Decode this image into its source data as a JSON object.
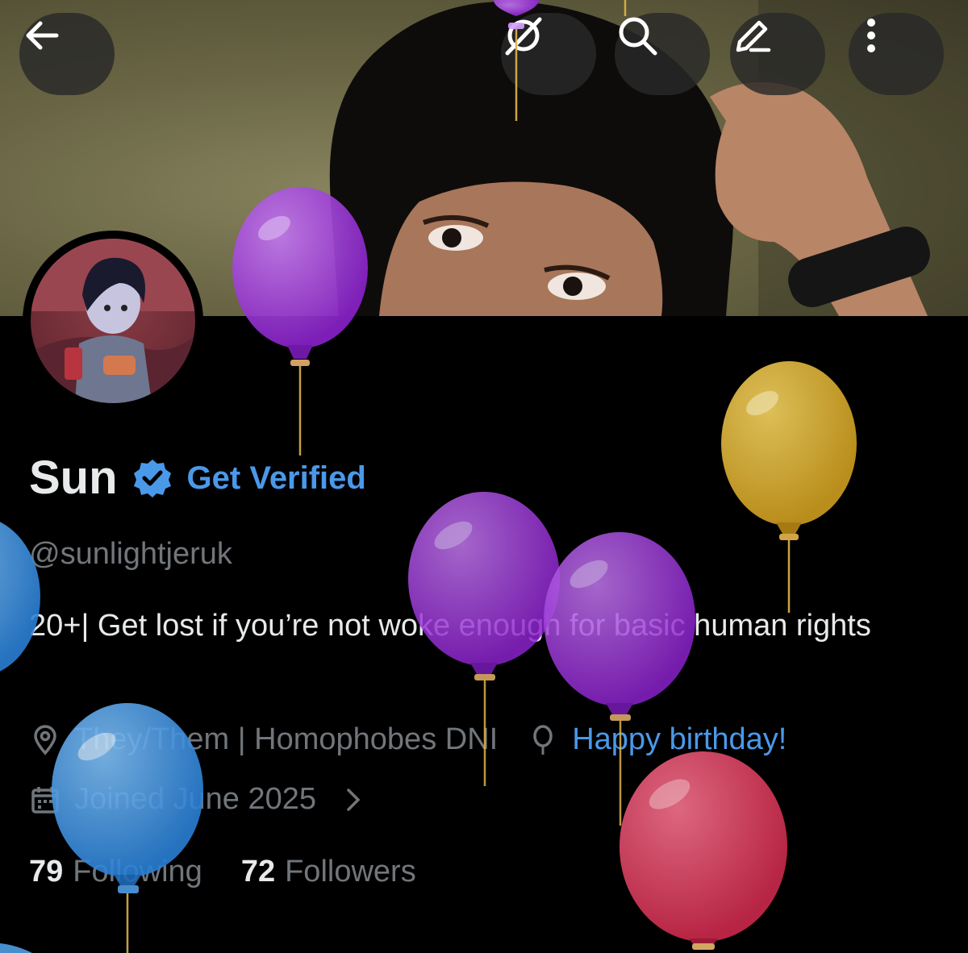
{
  "header": {
    "back_icon": "back-arrow-icon",
    "grok_icon": "grok-icon",
    "search_icon": "search-icon",
    "edit_icon": "edit-pencil-icon",
    "more_icon": "more-vertical-icon"
  },
  "profile": {
    "name": "Sun",
    "verified_icon": "verified-badge-icon",
    "get_verified_label": "Get Verified",
    "handle": "@sunlightjeruk",
    "bio": "20+| Get lost if you’re not woke enough for basic human rights",
    "location": "They/Them | Homophobes DNI",
    "birthday": "Happy birthday!",
    "joined": "Joined June 2025",
    "following_count": "79",
    "following_label": "Following",
    "followers_count": "72",
    "followers_label": "Followers"
  },
  "colors": {
    "accent": "#4a99e9",
    "muted_text": "#71767b",
    "text": "#e7e9ea",
    "balloon_purple": "#9b35d8",
    "balloon_gold": "#d6ae33",
    "balloon_red": "#d63b58",
    "balloon_blue": "#3d8ee0"
  }
}
